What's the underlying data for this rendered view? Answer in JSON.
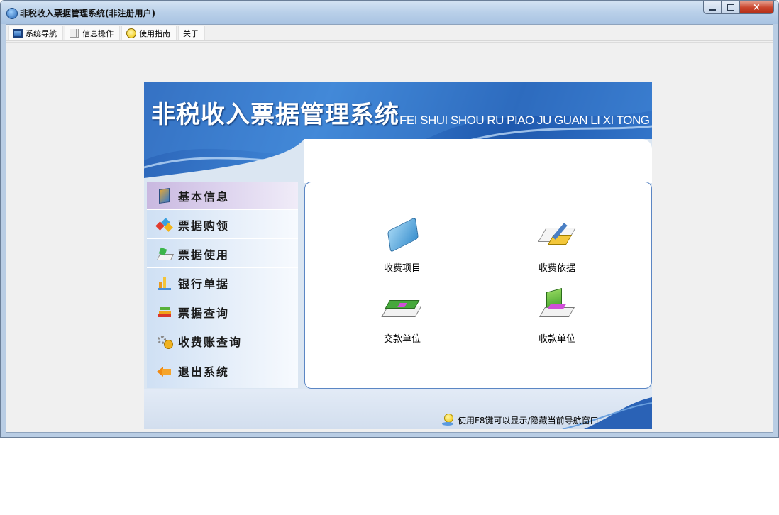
{
  "window": {
    "title": "非税收入票据管理系统(非注册用户)",
    "icon": "app-logo-icon",
    "controls": {
      "close": "×"
    }
  },
  "menu": {
    "items": [
      {
        "label": "系统导航",
        "icon": "monitor-icon"
      },
      {
        "label": "信息操作",
        "icon": "grid-icon"
      },
      {
        "label": "使用指南",
        "icon": "bulb-icon"
      },
      {
        "label": "关于",
        "icon": ""
      }
    ]
  },
  "banner": {
    "title": "非税收入票据管理系统",
    "pinyin": "FEI SHUI SHOU RU PIAO JU GUAN LI XI TONG"
  },
  "sidebar": {
    "items": [
      {
        "label": "基本信息",
        "icon": "book-icon",
        "active": true
      },
      {
        "label": "票据购领",
        "icon": "colored-shapes-icon",
        "active": false
      },
      {
        "label": "票据使用",
        "icon": "document-tray-icon",
        "active": false
      },
      {
        "label": "银行单据",
        "icon": "bank-chart-icon",
        "active": false
      },
      {
        "label": "票据查询",
        "icon": "books-stack-icon",
        "active": false
      },
      {
        "label": "收费账查询",
        "icon": "gears-icon",
        "active": false
      },
      {
        "label": "退出系统",
        "icon": "arrow-left-icon",
        "active": false
      }
    ]
  },
  "functions": {
    "items": [
      {
        "label": "收费项目",
        "icon": "blue-folder-icon"
      },
      {
        "label": "收费依据",
        "icon": "pen-papers-icon"
      },
      {
        "label": "交款单位",
        "icon": "cash-stack-icon"
      },
      {
        "label": "收款单位",
        "icon": "receipt-folder-icon"
      }
    ]
  },
  "footer": {
    "hint": "使用F8键可以显示/隐藏当前导航窗口"
  },
  "colors": {
    "banner_blue": "#2a62b6",
    "active_nav": "#c9b8e0",
    "content_border": "#5b86c4",
    "close_button": "#c9442c"
  }
}
